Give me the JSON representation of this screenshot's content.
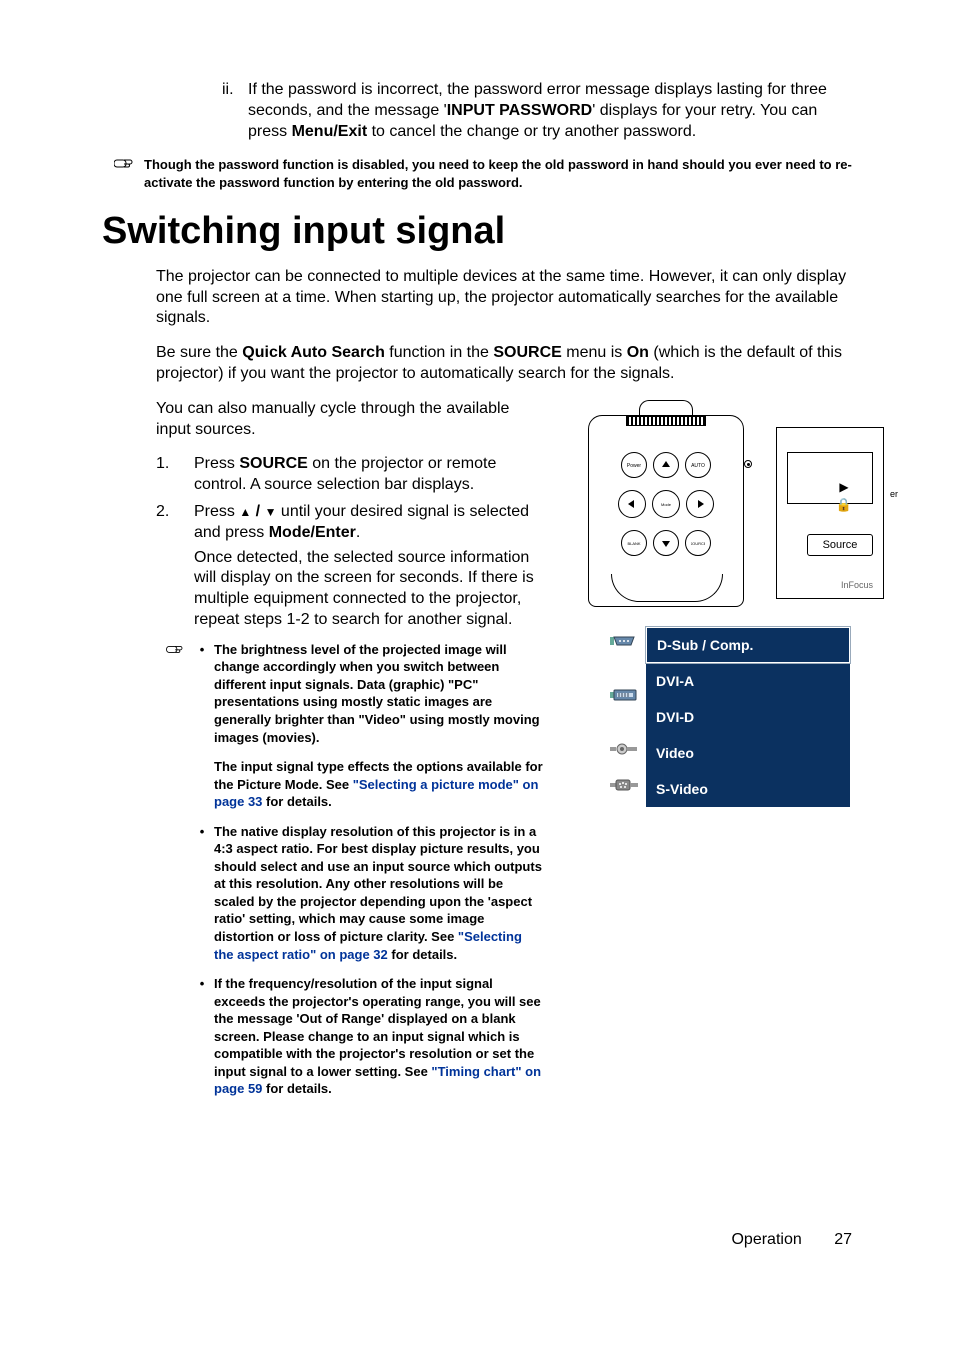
{
  "passwordNote": {
    "marker": "ii.",
    "line1_pre": "If the password is incorrect, the password error message displays lasting for three seconds, and the message '",
    "bold1": "INPUT PASSWORD",
    "line1_mid": "' displays for your retry. You can press ",
    "bold2": "Menu/Exit",
    "line1_post": " to cancel the change or try another password."
  },
  "noteDisabled": "Though the password function is disabled, you need to keep the old password in hand should you ever need to re-activate the password function by entering the old password.",
  "title": "Switching input signal",
  "intro1": "The projector can be connected to multiple devices at the same time. However, it can only display one full screen at a time. When starting up, the projector automatically searches for the available signals.",
  "intro2_pre": "Be sure the ",
  "intro2_b1": "Quick Auto Search",
  "intro2_mid1": " function in the ",
  "intro2_b2": "SOURCE",
  "intro2_mid2": " menu is ",
  "intro2_b3": "On",
  "intro2_post": " (which is the default of this projector) if you want the projector to automatically search for the signals.",
  "intro3": "You can also manually cycle through the available input sources.",
  "steps": {
    "s1_num": "1.",
    "s1_pre": "Press ",
    "s1_b": "SOURCE",
    "s1_post": " on the projector or remote control. A source selection bar displays.",
    "s2_num": "2.",
    "s2_pre": "Press ",
    "s2_sep": " / ",
    "s2_mid": " until your desired signal is selected and press ",
    "s2_b": "Mode/Enter",
    "s2_end": ".",
    "s2_p2": "Once detected, the selected source information will display on the screen for seconds. If there is multiple equipment connected to the projector, repeat steps 1-2 to search for another signal."
  },
  "notes": {
    "n1_pre": "The brightness level of the projected image will change accordingly when you switch between different input signals. Data (graphic) \"PC\" presentations using mostly static images are generally brighter than \"Video\" using mostly moving images (movies).",
    "n1b_pre": "The input signal type effects the options available for the Picture Mode. See ",
    "n1b_link": "\"Selecting a picture mode\" on page 33",
    "n1b_post": " for details.",
    "n2_pre": "The native display resolution of this projector is in a 4:3 aspect ratio. For best display picture results, you should select and use an input source which outputs at this resolution. Any other resolutions will be scaled by the projector depending upon the 'aspect ratio' setting, which may cause some image distortion or loss of picture clarity. See ",
    "n2_link": "\"Selecting the aspect ratio\" on page 32",
    "n2_post": " for details.",
    "n3_pre": "If the frequency/resolution of the input signal exceeds the projector's operating range, you will see the message 'Out of Range' displayed on a blank screen. Please change to an input signal which is compatible with the projector's resolution or set the input signal to a lower setting. See ",
    "n3_link": "\"Timing chart\" on page 59",
    "n3_post": " for details."
  },
  "device": {
    "er": "er",
    "source": "Source",
    "brand": "InFocus"
  },
  "menu": {
    "dsub": "D-Sub / Comp.",
    "dvia": "DVI-A",
    "dvid": "DVI-D",
    "video": "Video",
    "svideo": "S-Video"
  },
  "footer": {
    "section": "Operation",
    "page": "27"
  }
}
